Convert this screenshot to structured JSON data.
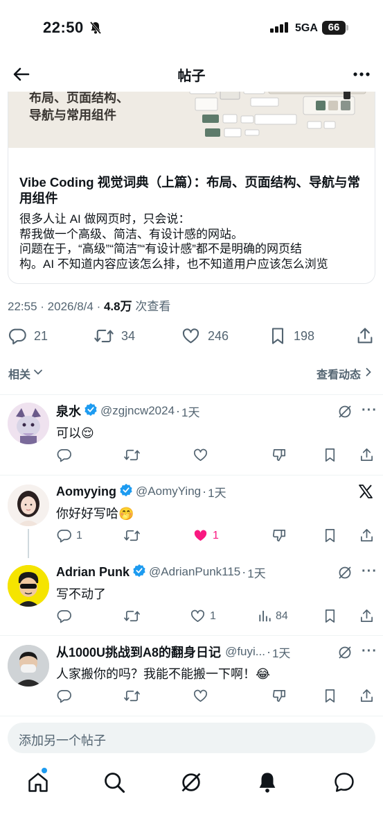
{
  "status_bar": {
    "time": "22:50",
    "network": "5GA",
    "battery": "66"
  },
  "header": {
    "title": "帖子"
  },
  "article_card": {
    "image_text": [
      "布局、页面结构、",
      "导航与常用组件"
    ],
    "title": "Vibe Coding 视觉词典（上篇）：布局、页面结构、导航与常用组件",
    "description_lines": [
      "很多人让 AI 做网页时，只会说：",
      "帮我做一个高级、简洁、有设计感的网站。",
      "问题在于，“高级”“简洁”“有设计感”都不是明确的网页结",
      "构。AI 不知道内容应该怎么排，也不知道用户应该怎么浏览"
    ]
  },
  "post_meta": {
    "time": "22:55",
    "date": "2026/8/4",
    "views": "4.8万",
    "views_label": "次查看"
  },
  "post_actions": {
    "replies": "21",
    "reposts": "34",
    "likes": "246",
    "bookmarks": "198"
  },
  "related_bar": {
    "left_label": "相关",
    "right_label": "查看动态"
  },
  "replies": [
    {
      "name": "泉水",
      "handle": "@zgjncw2024",
      "time": "1天",
      "text": "可以😌",
      "likes": "",
      "views": ""
    },
    {
      "name": "Aomyying",
      "handle": "@AomyYing",
      "time": "1天",
      "text": "你好好写哈🤭",
      "replies": "1",
      "likes": "1"
    },
    {
      "name": "Adrian Punk",
      "handle": "@AdrianPunk115",
      "time": "1天",
      "text": "写不动了",
      "likes": "1",
      "views": "84"
    },
    {
      "name": "从1000U挑战到A8的翻身日记",
      "handle": "@fuyi...",
      "time": "1天",
      "text": "人家搬你的吗？我能不能搬一下啊！😂"
    }
  ],
  "compose": {
    "placeholder": "添加另一个帖子"
  },
  "colors": {
    "accent": "#1d9bf0",
    "like_active": "#f91880",
    "secondary_text": "#536471",
    "verified": "#1d9bf0"
  },
  "icons": {
    "tabs": [
      "home-icon",
      "search-icon",
      "grok-icon",
      "notifications-icon",
      "messages-icon"
    ]
  }
}
